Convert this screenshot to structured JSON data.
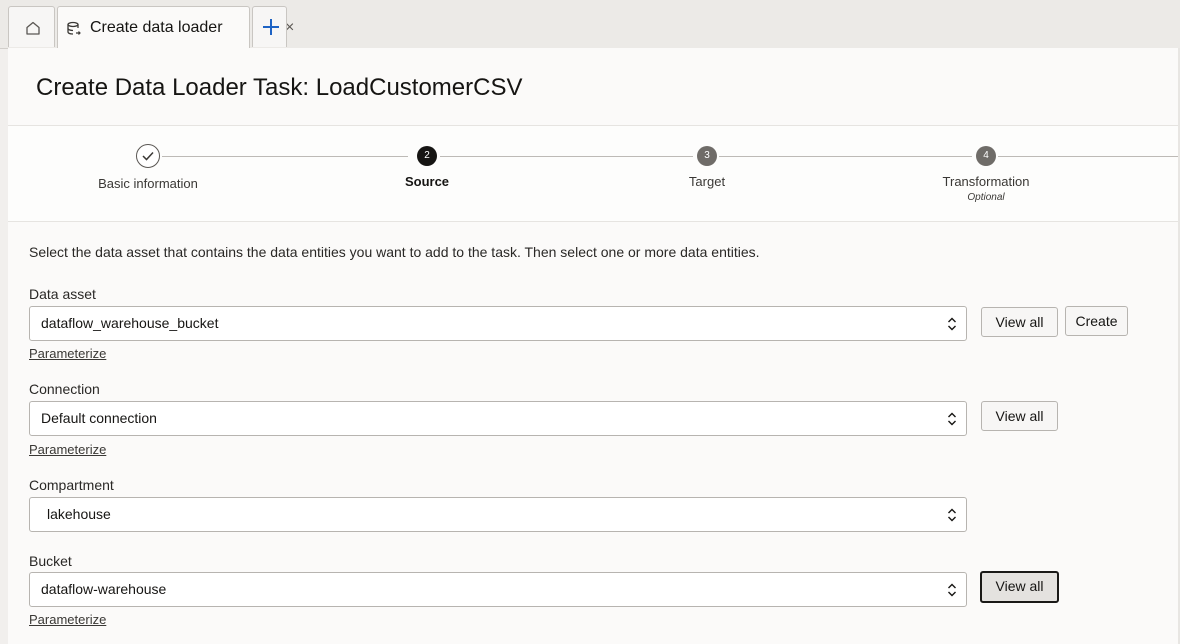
{
  "tabs": {
    "active_label": "Create data loader",
    "close_glyph": "×",
    "home_icon": "home-icon",
    "add_icon": "plus-icon"
  },
  "page": {
    "title": "Create Data Loader Task: LoadCustomerCSV"
  },
  "steps": [
    {
      "number": "1",
      "label": "Basic information",
      "state": "complete",
      "sublabel": ""
    },
    {
      "number": "2",
      "label": "Source",
      "state": "current",
      "sublabel": ""
    },
    {
      "number": "3",
      "label": "Target",
      "state": "upcoming",
      "sublabel": ""
    },
    {
      "number": "4",
      "label": "Transformation",
      "state": "upcoming",
      "sublabel": "Optional"
    }
  ],
  "instructions": "Select the data asset that contains the data entities you want to add to the task. Then select one or more data entities.",
  "form": {
    "data_asset": {
      "label": "Data asset",
      "value": "dataflow_warehouse_bucket",
      "parameterize": "Parameterize",
      "view_all": "View all",
      "create": "Create"
    },
    "connection": {
      "label": "Connection",
      "value": "Default connection",
      "parameterize": "Parameterize",
      "view_all": "View all"
    },
    "compartment": {
      "label": "Compartment",
      "value": "lakehouse"
    },
    "bucket": {
      "label": "Bucket",
      "value": "dataflow-warehouse",
      "parameterize": "Parameterize",
      "view_all": "View all"
    }
  },
  "colors": {
    "accent": "#1e63c4",
    "step_current": "#161513",
    "step_upcoming": "#6f6c68"
  }
}
